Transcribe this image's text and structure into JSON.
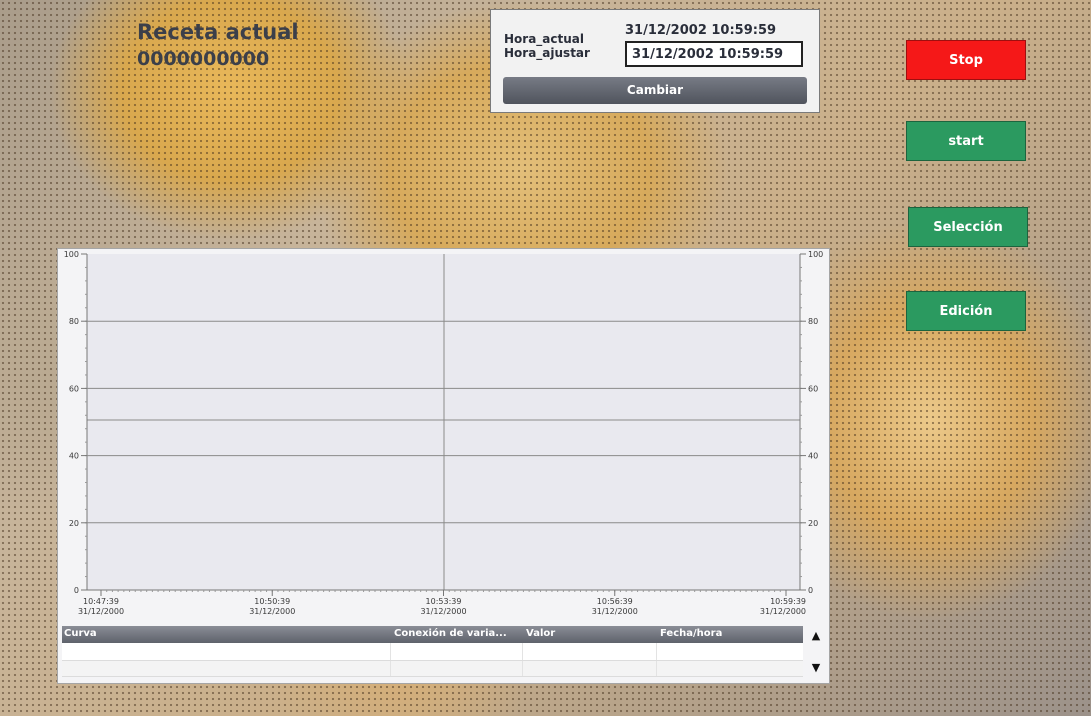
{
  "recipe": {
    "title": "Receta actual",
    "value": "0000000000"
  },
  "time_panel": {
    "label_current": "Hora_actual",
    "label_adjust": "Hora_ajustar",
    "current_time": "31/12/2002 10:59:59",
    "adjust_value": "31/12/2002 10:59:59",
    "change_button": "Cambiar"
  },
  "buttons": {
    "stop": "Stop",
    "start": "start",
    "selection": "Selección",
    "edit": "Edición"
  },
  "colors": {
    "stop": "#f51818",
    "green": "#2b9a60",
    "panel": "#f2f2f2",
    "header": "#5e626b"
  },
  "chart_data": {
    "type": "line",
    "y_ticks": [
      "0",
      "20",
      "40",
      "60",
      "80",
      "100"
    ],
    "x_ticks": [
      {
        "time": "10:47:39",
        "date": "31/12/2000"
      },
      {
        "time": "10:50:39",
        "date": "31/12/2000"
      },
      {
        "time": "10:53:39",
        "date": "31/12/2000"
      },
      {
        "time": "10:56:39",
        "date": "31/12/2000"
      },
      {
        "time": "10:59:39",
        "date": "31/12/2000"
      }
    ],
    "ylim": [
      0,
      100
    ],
    "grid": true,
    "series": []
  },
  "table": {
    "columns": [
      "Curva",
      "Conexión de varia...",
      "Valor",
      "Fecha/hora"
    ],
    "rows": [],
    "scroll_up_icon": "triangle-up",
    "scroll_down_icon": "triangle-down"
  }
}
